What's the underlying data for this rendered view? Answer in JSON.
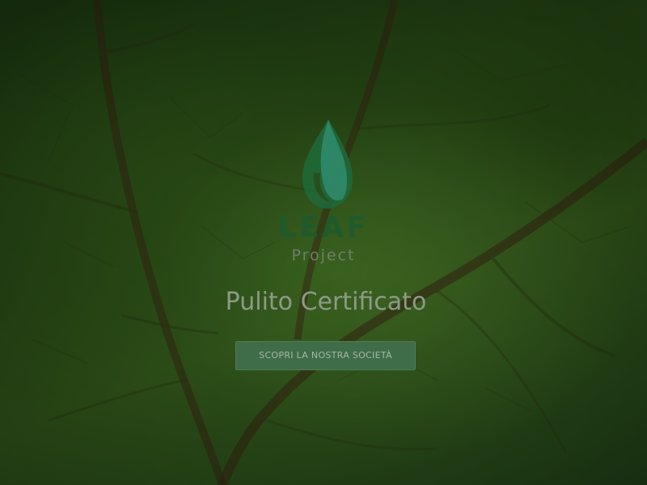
{
  "hero": {
    "background": "leaf-macro-photo",
    "overlay_color": "#000000"
  },
  "logo": {
    "icon": "leaf-drop-icon",
    "brand_word": "LEAF",
    "brand_sub": "Project",
    "colors": {
      "mark_dark": "#1f6a39",
      "mark_light": "#2f8a6a",
      "brand_word": "#1f5a2c",
      "brand_sub": "#6f7f6a"
    }
  },
  "tagline": "Pulito Certificato",
  "cta": {
    "label": "SCOPRI LA NOSTRA SOCIETÀ",
    "background": "#3f6d4a",
    "text_color": "#a7b6a3"
  }
}
